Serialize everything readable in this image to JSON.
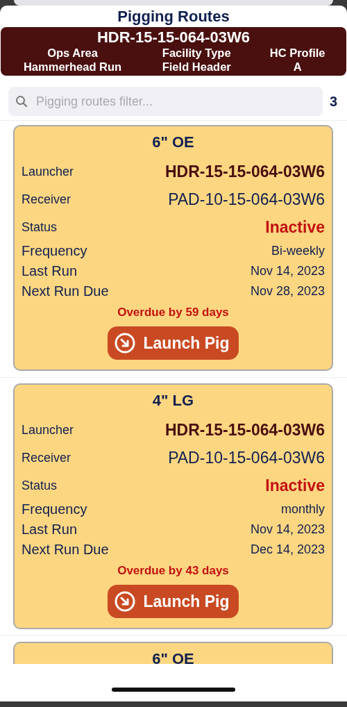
{
  "title": "Pigging Routes",
  "header": {
    "facility": "HDR-15-15-064-03W6",
    "fields": [
      {
        "label": "Ops Area",
        "value": "Hammerhead Run"
      },
      {
        "label": "Facility Type",
        "value": "Field Header"
      },
      {
        "label": "HC Profile",
        "value": "A"
      }
    ]
  },
  "search": {
    "placeholder": "Pigging routes filter...",
    "count": "3"
  },
  "routes": [
    {
      "name": "6\" OE",
      "launcher_label": "Launcher",
      "launcher": "HDR-15-15-064-03W6",
      "receiver_label": "Receiver",
      "receiver": "PAD-10-15-064-03W6",
      "status_label": "Status",
      "status": "Inactive",
      "details": [
        {
          "label": "Frequency",
          "value": "Bi-weekly"
        },
        {
          "label": "Last Run",
          "value": "Nov 14, 2023"
        },
        {
          "label": "Next Run Due",
          "value": "Nov 28, 2023"
        }
      ],
      "overdue": "Overdue by 59 days",
      "action": "Launch Pig"
    },
    {
      "name": "4\" LG",
      "launcher_label": "Launcher",
      "launcher": "HDR-15-15-064-03W6",
      "receiver_label": "Receiver",
      "receiver": "PAD-10-15-064-03W6",
      "status_label": "Status",
      "status": "Inactive",
      "details": [
        {
          "label": "Frequency",
          "value": "monthly"
        },
        {
          "label": "Last Run",
          "value": "Nov 14, 2023"
        },
        {
          "label": "Next Run Due",
          "value": "Dec 14, 2023"
        }
      ],
      "overdue": "Overdue by 43 days",
      "action": "Launch Pig"
    },
    {
      "name": "6\" OE"
    }
  ]
}
